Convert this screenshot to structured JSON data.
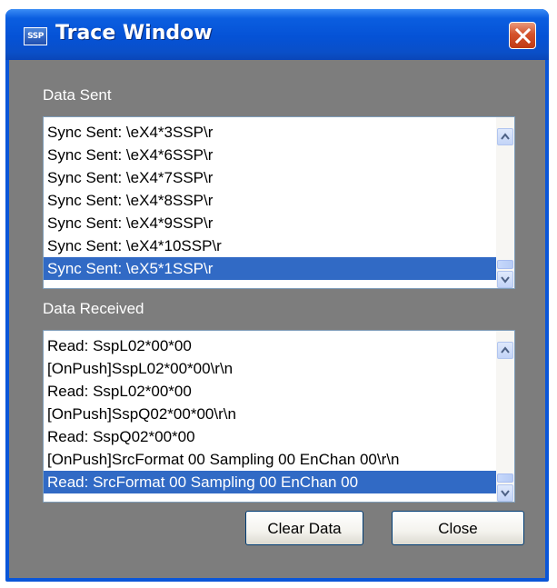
{
  "window": {
    "title": "Trace Window",
    "app_icon_text": "SSP"
  },
  "data_sent": {
    "label": "Data Sent",
    "items": [
      "Sync Sent: \\eX4*3SSP\\r",
      "Sync Sent: \\eX4*6SSP\\r",
      "Sync Sent: \\eX4*7SSP\\r",
      "Sync Sent: \\eX4*8SSP\\r",
      "Sync Sent: \\eX4*9SSP\\r",
      "Sync Sent: \\eX4*10SSP\\r",
      "Sync Sent: \\eX5*1SSP\\r"
    ],
    "selected_index": 6
  },
  "data_received": {
    "label": "Data Received",
    "items": [
      "Read: SspL02*00*00",
      "[OnPush]SspL02*00*00\\r\\n",
      "Read: SspL02*00*00",
      "[OnPush]SspQ02*00*00\\r\\n",
      "Read: SspQ02*00*00",
      "[OnPush]SrcFormat 00 Sampling 00 EnChan 00\\r\\n",
      "Read: SrcFormat 00 Sampling 00 EnChan 00"
    ],
    "selected_index": 6
  },
  "buttons": {
    "clear": "Clear Data",
    "close": "Close"
  },
  "colors": {
    "titlebar": "#0552d6",
    "client": "#7d7d7d",
    "selection": "#316ac5",
    "close_button": "#d4532c"
  },
  "icons": {
    "close": "close-icon",
    "app": "ssp-app-icon",
    "scroll_up": "chevron-up-icon",
    "scroll_down": "chevron-down-icon"
  }
}
